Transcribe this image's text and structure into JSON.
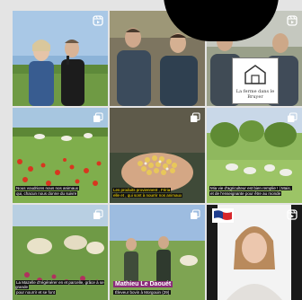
{
  "posts": [
    {
      "type": "reel"
    },
    {
      "type": "reel"
    },
    {
      "type": "reel",
      "logo_text": "La ferme dans le Bruyer"
    },
    {
      "type": "multi",
      "caption_line1": "Nous voudrions nous nos animaux",
      "caption_line2": "qui, chacun nous donne du suivre"
    },
    {
      "type": "multi",
      "caption_line1": "Les produits proviennent , Féria",
      "caption_line2": "elle et , qui sont à nourrir nos animaux"
    },
    {
      "type": "multi",
      "caption_line1": "Mia vie d'agriculteur est bien remplie ! | Mais,",
      "caption_line2": "et de l'enseignante pour être au monde"
    },
    {
      "type": "multi",
      "caption_line1": "La Mazelle d'régénérer en et parcelle, grâce à se grande",
      "caption_line2": "pour nourrir et se font"
    },
    {
      "type": "multi",
      "name": "Mathieu Le Daouét",
      "subtitle": "Éleveur bovin à Morgouin (29)"
    },
    {
      "type": "reel"
    }
  ]
}
